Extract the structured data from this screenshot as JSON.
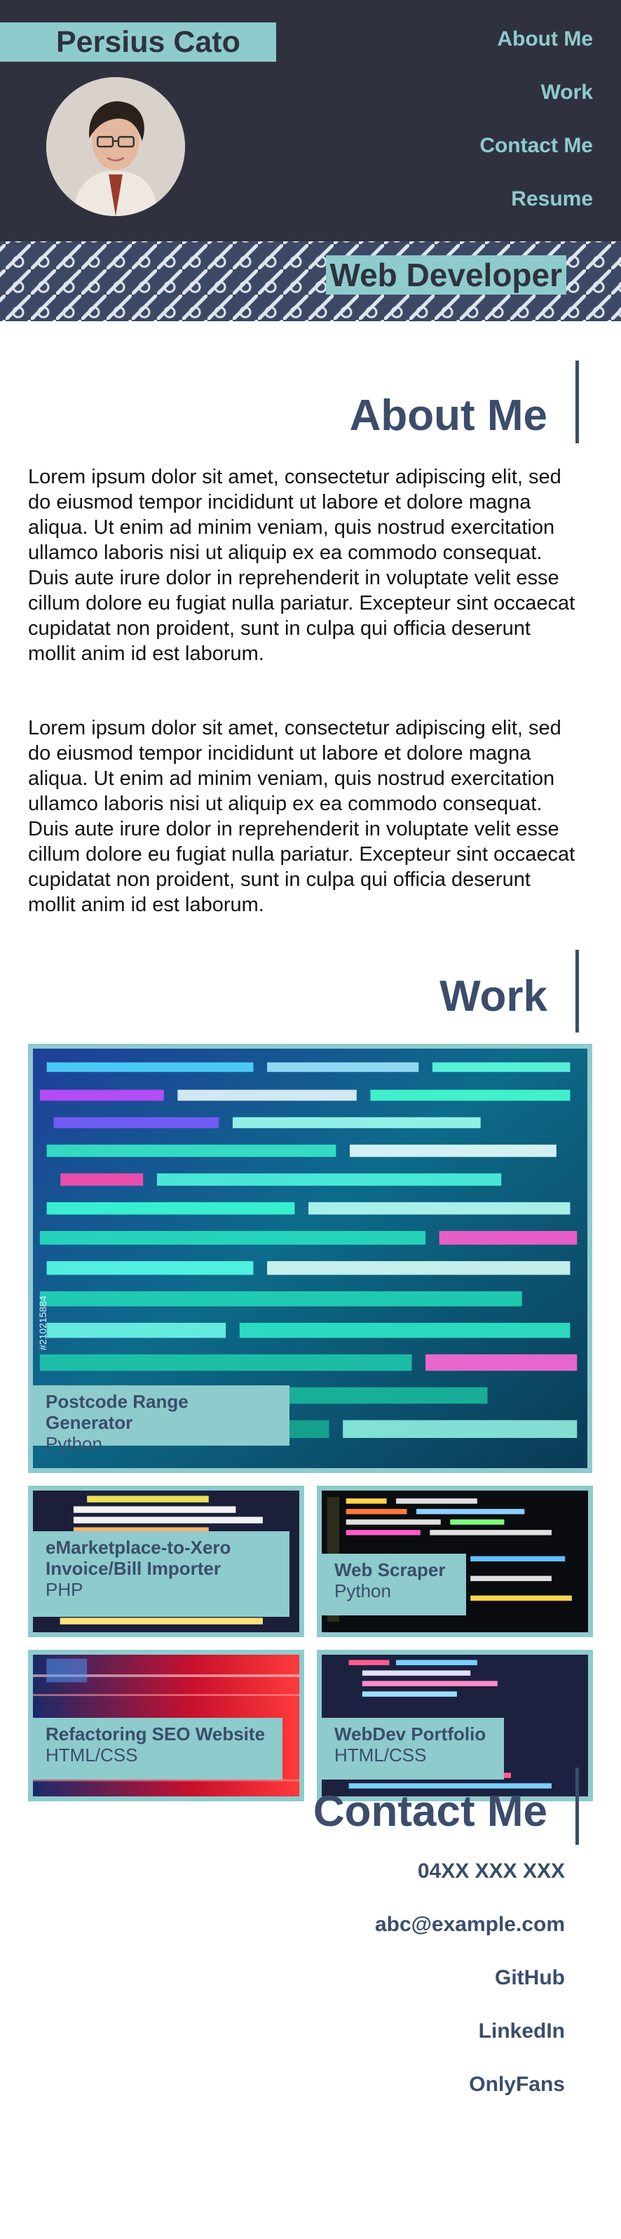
{
  "header": {
    "name": "Persius Cato",
    "nav": [
      "About Me",
      "Work",
      "Contact Me",
      "Resume"
    ],
    "tagline": "Web Developer"
  },
  "about": {
    "heading": "About Me",
    "paragraphs": [
      "Lorem ipsum dolor sit amet, consectetur adipiscing elit, sed do eiusmod tempor incididunt ut labore et dolore magna aliqua. Ut enim ad minim veniam, quis nostrud exercitation ullamco laboris nisi ut aliquip ex ea commodo consequat. Duis aute irure dolor in reprehenderit in voluptate velit esse cillum dolore eu fugiat nulla pariatur. Excepteur sint occaecat cupidatat non proident, sunt in culpa qui officia deserunt mollit anim id est laborum.",
      "Lorem ipsum dolor sit amet, consectetur adipiscing elit, sed do eiusmod tempor incididunt ut labore et dolore magna aliqua. Ut enim ad minim veniam, quis nostrud exercitation ullamco laboris nisi ut aliquip ex ea commodo consequat. Duis aute irure dolor in reprehenderit in voluptate velit esse cillum dolore eu fugiat nulla pariatur. Excepteur sint occaecat cupidatat non proident, sunt in culpa qui officia deserunt mollit anim id est laborum."
    ]
  },
  "work": {
    "heading": "Work",
    "projects": [
      {
        "title": "Postcode Range Generator",
        "lang": "Python"
      },
      {
        "title": "eMarketplace-to-Xero Invoice/Bill Importer",
        "lang": "PHP"
      },
      {
        "title": "Web Scraper",
        "lang": "Python"
      },
      {
        "title": "Refactoring SEO Website",
        "lang": "HTML/CSS"
      },
      {
        "title": "WebDev Portfolio",
        "lang": "HTML/CSS"
      }
    ],
    "image_credit": "#210215884"
  },
  "contact": {
    "heading": "Contact Me",
    "items": [
      "04XX XXX XXX",
      "abc@example.com",
      "GitHub",
      "LinkedIn",
      "OnlyFans"
    ]
  },
  "colors": {
    "header_bg": "#2f323e",
    "accent_teal": "#8ecbcd",
    "heading_navy": "#3b4d6b",
    "banner_bg": "#3d4964"
  }
}
